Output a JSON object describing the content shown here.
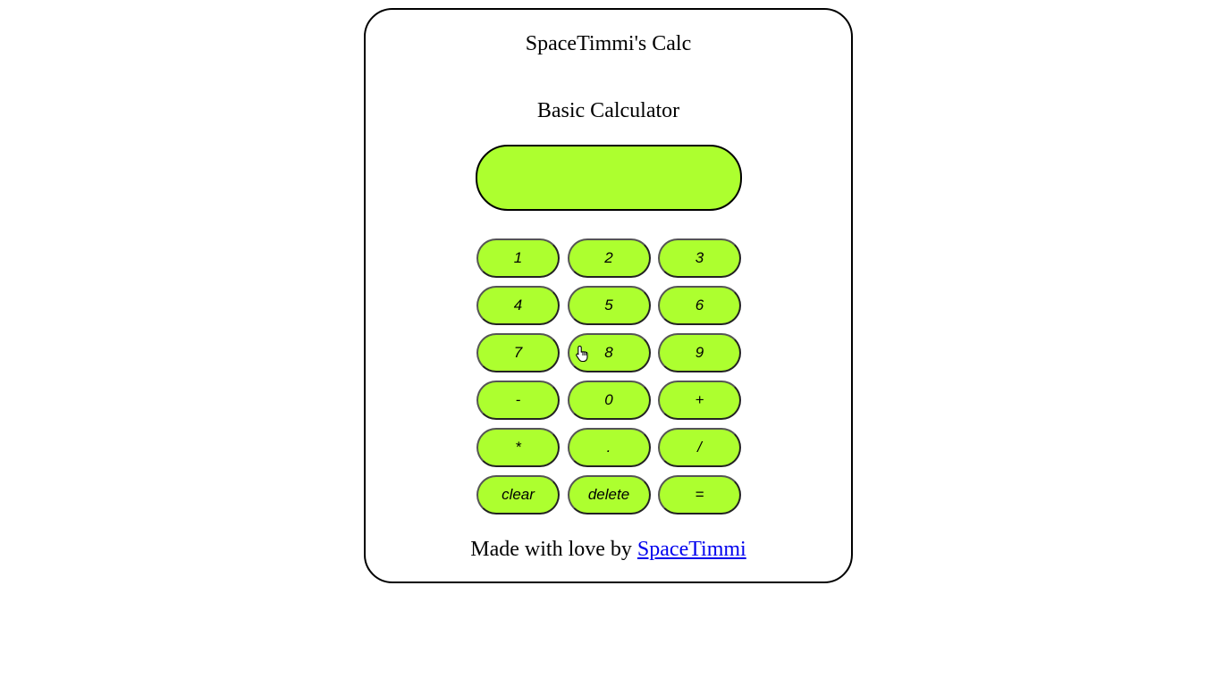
{
  "app": {
    "title": "SpaceTimmi's Calc",
    "subtitle": "Basic Calculator"
  },
  "display": {
    "value": ""
  },
  "keypad": {
    "keys": [
      "1",
      "2",
      "3",
      "4",
      "5",
      "6",
      "7",
      "8",
      "9",
      "-",
      "0",
      "+",
      "*",
      ".",
      "/",
      "clear",
      "delete",
      "="
    ]
  },
  "footer": {
    "text": "Made with love by ",
    "link_label": "SpaceTimmi"
  },
  "colors": {
    "accent": "#adff2f",
    "link": "#0000ee",
    "border": "#000000"
  },
  "icons": {
    "cursor": "hand-pointer-icon"
  }
}
